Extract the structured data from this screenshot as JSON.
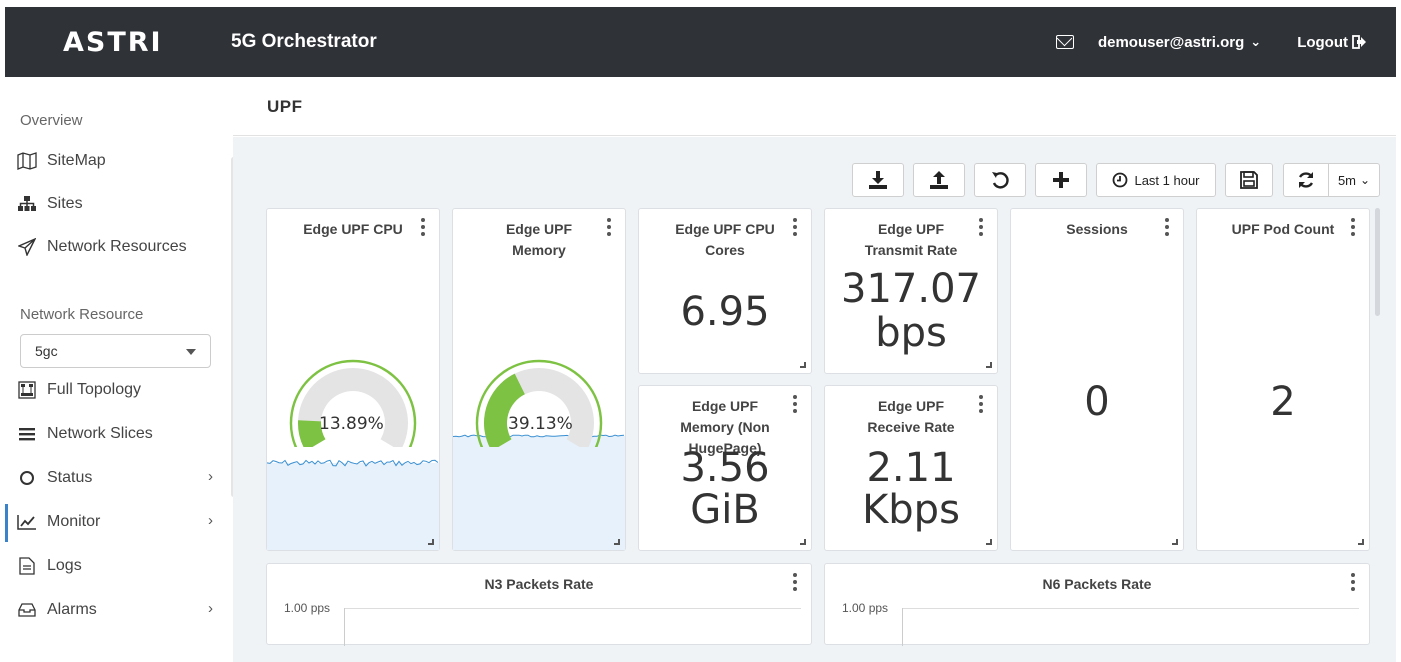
{
  "header": {
    "brand": "ASTRI",
    "app_title": "5G Orchestrator",
    "user": "demouser@astri.org",
    "logout": "Logout"
  },
  "sidebar": {
    "section_overview": "Overview",
    "items_top": [
      {
        "label": "SiteMap",
        "icon": "map-icon"
      },
      {
        "label": "Sites",
        "icon": "sitemap-icon"
      },
      {
        "label": "Network Resources",
        "icon": "paper-plane-icon"
      }
    ],
    "section_resource": "Network Resource",
    "resource_selected": "5gc",
    "items_bottom": [
      {
        "label": "Full Topology",
        "icon": "topology-icon"
      },
      {
        "label": "Network Slices",
        "icon": "bars-icon"
      },
      {
        "label": "Status",
        "icon": "circle-icon"
      },
      {
        "label": "Monitor",
        "icon": "chart-line-icon"
      },
      {
        "label": "Logs",
        "icon": "document-icon"
      },
      {
        "label": "Alarms",
        "icon": "inbox-icon"
      }
    ]
  },
  "page": {
    "title": "UPF"
  },
  "toolbar": {
    "time_range": "Last 1 hour",
    "refresh_interval": "5m"
  },
  "panels": {
    "cpu": {
      "title": "Edge UPF CPU",
      "value": "13.89%",
      "fraction": 0.1389
    },
    "memory": {
      "title": "Edge UPF Memory",
      "value": "39.13%",
      "fraction": 0.3913
    },
    "cpu_cores": {
      "title": "Edge UPF CPU Cores",
      "value": "6.95"
    },
    "tx_rate": {
      "title": "Edge UPF Transmit Rate",
      "value": "317.07",
      "unit": "bps"
    },
    "mem_nonhuge": {
      "title": "Edge UPF Memory (Non HugePage)",
      "value": "3.56",
      "unit": "GiB"
    },
    "rx_rate": {
      "title": "Edge UPF Receive Rate",
      "value": "2.11",
      "unit": "Kbps"
    },
    "sessions": {
      "title": "Sessions",
      "value": "0"
    },
    "pod_count": {
      "title": "UPF Pod Count",
      "value": "2"
    },
    "n3": {
      "title": "N3 Packets Rate",
      "ytick": "1.00 pps"
    },
    "n6": {
      "title": "N6 Packets Rate",
      "ytick": "1.00 pps"
    }
  },
  "colors": {
    "topbar": "#2f3237",
    "gauge_fill": "#7dc242",
    "gauge_track": "#e4e4e4",
    "sparkline": "#3a8fd1"
  }
}
